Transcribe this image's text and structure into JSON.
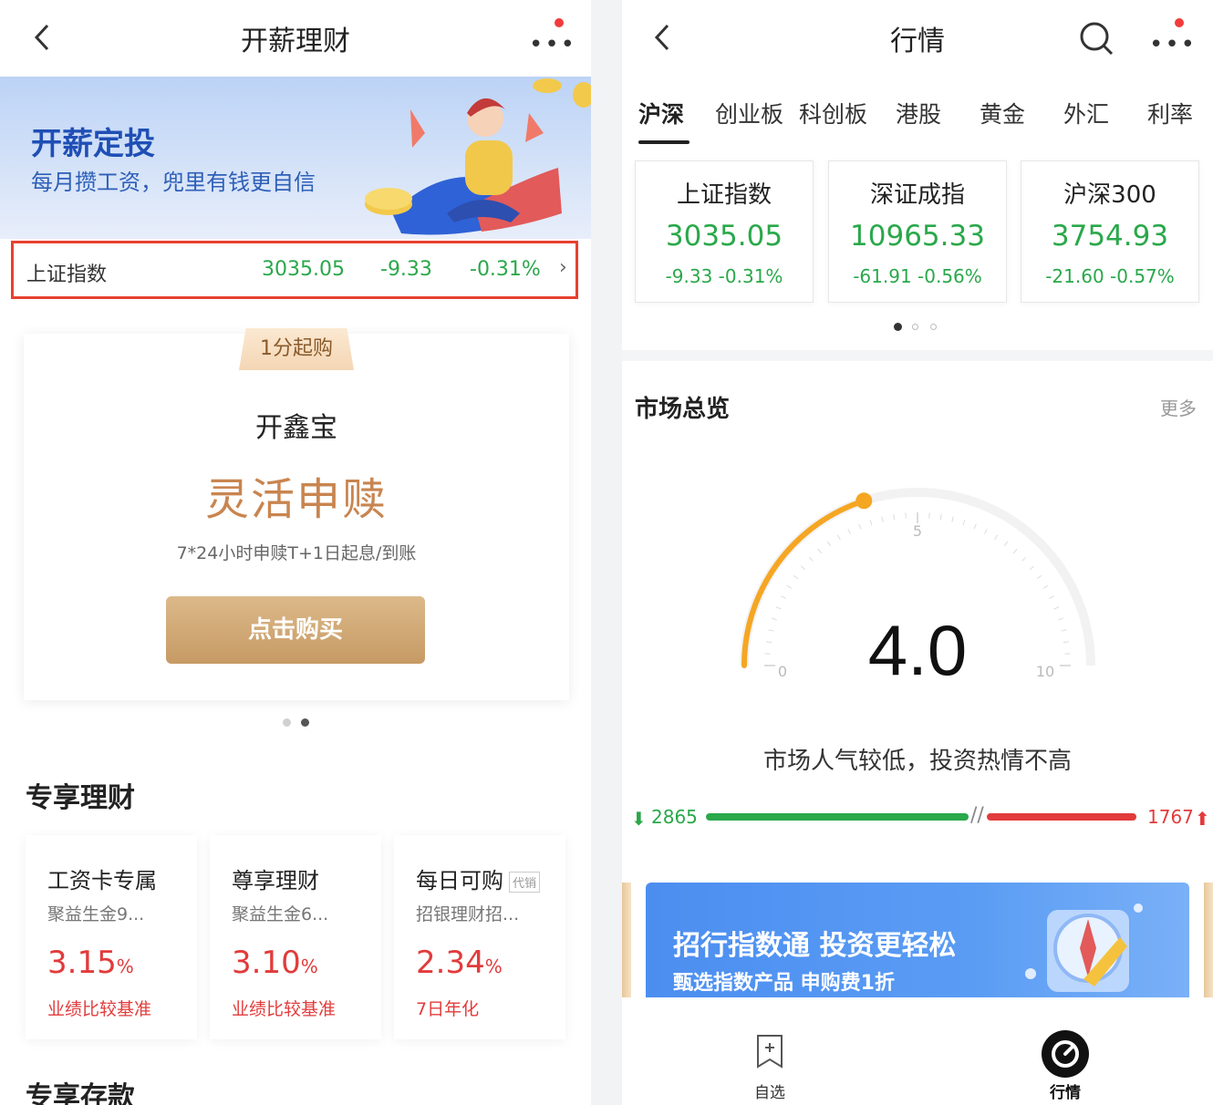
{
  "left": {
    "header": {
      "title": "开薪理财"
    },
    "banner": {
      "title": "开薪定投",
      "subtitle": "每月攒工资，兜里有钱更自信"
    },
    "index_strip": {
      "name": "上证指数",
      "value": "3035.05",
      "change": "-9.33",
      "percent": "-0.31%",
      "arrow": "›"
    },
    "product": {
      "tag": "1分起购",
      "name": "开鑫宝",
      "slogan": "灵活申赎",
      "description": "7*24小时申赎T+1日起息/到账",
      "button": "点击购买"
    },
    "exclusive_finance": {
      "title": "专享理财",
      "cards": [
        {
          "title": "工资卡专属",
          "badge": "",
          "subtitle": "聚益生金9...",
          "rate": "3.15",
          "unit": "%",
          "label": "业绩比较基准"
        },
        {
          "title": "尊享理财",
          "badge": "",
          "subtitle": "聚益生金6...",
          "rate": "3.10",
          "unit": "%",
          "label": "业绩比较基准"
        },
        {
          "title": "每日可购",
          "badge": "代销",
          "subtitle": "招银理财招...",
          "rate": "2.34",
          "unit": "%",
          "label": "7日年化"
        }
      ]
    },
    "exclusive_deposit": {
      "title": "专享存款"
    }
  },
  "right": {
    "header": {
      "title": "行情"
    },
    "tabs": [
      "沪深",
      "创业板",
      "科创板",
      "港股",
      "黄金",
      "外汇",
      "利率"
    ],
    "active_tab": 0,
    "indices": [
      {
        "name": "上证指数",
        "value": "3035.05",
        "change": "-9.33 -0.31%"
      },
      {
        "name": "深证成指",
        "value": "10965.33",
        "change": "-61.91 -0.56%"
      },
      {
        "name": "沪深300",
        "value": "3754.93",
        "change": "-21.60 -0.57%"
      }
    ],
    "market": {
      "title": "市场总览",
      "more": "更多",
      "gauge_value": 4.0,
      "gauge_value_text": "4.0",
      "gauge_min_label": "0",
      "gauge_mid_label": "5",
      "gauge_max_label": "10",
      "description": "市场人气较低，投资热情不高",
      "declining": "2865",
      "advancing": "1767"
    },
    "promo": {
      "title": "招行指数通 投资更轻松",
      "subtitle": "甄选指数产品 申购费1折"
    },
    "bottom_nav": [
      {
        "label": "自选"
      },
      {
        "label": "行情"
      }
    ]
  },
  "colors": {
    "down_green": "#2aa84a",
    "up_red": "#e23b3b",
    "gold": "#c88550",
    "brand_blue": "#1f4fb5",
    "gauge_orange": "#f5a623"
  }
}
